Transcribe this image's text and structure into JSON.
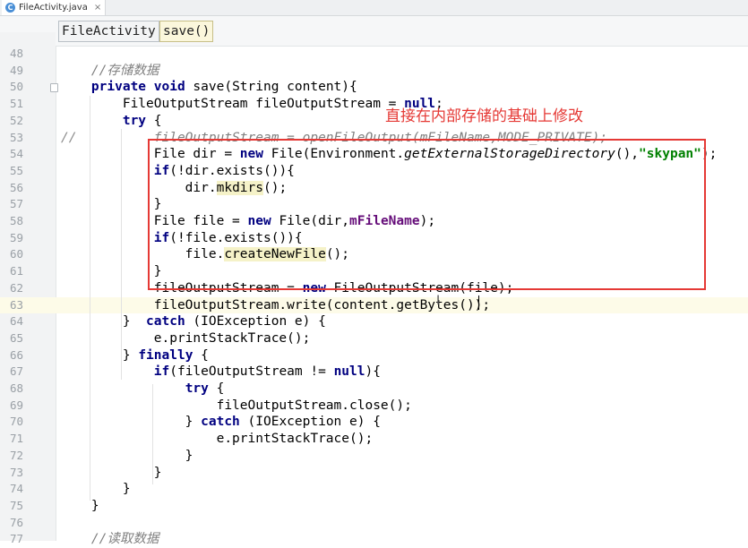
{
  "tab": {
    "icon": "C",
    "title": "FileActivity.java",
    "close": "×"
  },
  "breadcrumbs": [
    "FileActivity",
    "save()"
  ],
  "annotation": "直接在内部存储的基础上修改",
  "lines": [
    {
      "n": "48",
      "indent": 0,
      "tokens": []
    },
    {
      "n": "49",
      "indent": 0,
      "tokens": [
        {
          "t": "    //存储数据",
          "c": "cm"
        }
      ]
    },
    {
      "n": "50",
      "indent": 0,
      "fold": true,
      "tokens": [
        {
          "t": "    "
        },
        {
          "t": "private",
          "c": "kw"
        },
        {
          "t": " "
        },
        {
          "t": "void",
          "c": "kw"
        },
        {
          "t": " save(String content){"
        }
      ]
    },
    {
      "n": "51",
      "indent": 0,
      "tokens": [
        {
          "t": "        FileOutputStream fileOutputStream = "
        },
        {
          "t": "null",
          "c": "kw"
        },
        {
          "t": ";"
        }
      ]
    },
    {
      "n": "52",
      "indent": 0,
      "tokens": [
        {
          "t": "        "
        },
        {
          "t": "try",
          "c": "kw"
        },
        {
          "t": " {"
        }
      ]
    },
    {
      "n": "53",
      "indent": 0,
      "comment_marker": "//",
      "tokens": [
        {
          "t": "            fileOutputStream = openFileOutput(mFileName,MODE_PRIVATE);",
          "c": "cm"
        }
      ]
    },
    {
      "n": "54",
      "indent": 0,
      "tokens": [
        {
          "t": "            File dir = "
        },
        {
          "t": "new",
          "c": "kw"
        },
        {
          "t": " File(Environment."
        },
        {
          "t": "getExternalStorageDirectory",
          "c": "it"
        },
        {
          "t": "(),"
        },
        {
          "t": "\"skypan\"",
          "c": "st"
        },
        {
          "t": ");"
        }
      ]
    },
    {
      "n": "55",
      "indent": 0,
      "tokens": [
        {
          "t": "            "
        },
        {
          "t": "if",
          "c": "kw"
        },
        {
          "t": "(!dir.exists()){"
        }
      ]
    },
    {
      "n": "56",
      "indent": 0,
      "tokens": [
        {
          "t": "                dir."
        },
        {
          "t": "mkdirs",
          "c": "hl"
        },
        {
          "t": "();"
        }
      ]
    },
    {
      "n": "57",
      "indent": 0,
      "tokens": [
        {
          "t": "            }"
        }
      ]
    },
    {
      "n": "58",
      "indent": 0,
      "tokens": [
        {
          "t": "            File file = "
        },
        {
          "t": "new",
          "c": "kw"
        },
        {
          "t": " File(dir,"
        },
        {
          "t": "mFileName",
          "c": "fld"
        },
        {
          "t": ");"
        }
      ]
    },
    {
      "n": "59",
      "indent": 0,
      "tokens": [
        {
          "t": "            "
        },
        {
          "t": "if",
          "c": "kw"
        },
        {
          "t": "(!file.exists()){"
        }
      ]
    },
    {
      "n": "60",
      "indent": 0,
      "tokens": [
        {
          "t": "                file."
        },
        {
          "t": "createNewFile",
          "c": "hl"
        },
        {
          "t": "();"
        }
      ]
    },
    {
      "n": "61",
      "indent": 0,
      "tokens": [
        {
          "t": "            }"
        }
      ]
    },
    {
      "n": "62",
      "indent": 0,
      "tokens": [
        {
          "t": "            fileOutputStream = "
        },
        {
          "t": "new",
          "c": "kw"
        },
        {
          "t": " FileOutputStream(file);"
        }
      ]
    },
    {
      "n": "63",
      "indent": 0,
      "current": true,
      "tokens": [
        {
          "t": "            fileOutputStream.write(content.getBytes());"
        }
      ]
    },
    {
      "n": "64",
      "indent": 0,
      "tokens": [
        {
          "t": "        }  "
        },
        {
          "t": "catch",
          "c": "kw"
        },
        {
          "t": " (IOException e) {"
        }
      ]
    },
    {
      "n": "65",
      "indent": 0,
      "tokens": [
        {
          "t": "            e.printStackTrace();"
        }
      ]
    },
    {
      "n": "66",
      "indent": 0,
      "tokens": [
        {
          "t": "        } "
        },
        {
          "t": "finally",
          "c": "kw"
        },
        {
          "t": " {"
        }
      ]
    },
    {
      "n": "67",
      "indent": 0,
      "tokens": [
        {
          "t": "            "
        },
        {
          "t": "if",
          "c": "kw"
        },
        {
          "t": "(fileOutputStream != "
        },
        {
          "t": "null",
          "c": "kw"
        },
        {
          "t": "){"
        }
      ]
    },
    {
      "n": "68",
      "indent": 0,
      "tokens": [
        {
          "t": "                "
        },
        {
          "t": "try",
          "c": "kw"
        },
        {
          "t": " {"
        }
      ]
    },
    {
      "n": "69",
      "indent": 0,
      "tokens": [
        {
          "t": "                    fileOutputStream.close();"
        }
      ]
    },
    {
      "n": "70",
      "indent": 0,
      "tokens": [
        {
          "t": "                } "
        },
        {
          "t": "catch",
          "c": "kw"
        },
        {
          "t": " (IOException e) {"
        }
      ]
    },
    {
      "n": "71",
      "indent": 0,
      "tokens": [
        {
          "t": "                    e.printStackTrace();"
        }
      ]
    },
    {
      "n": "72",
      "indent": 0,
      "tokens": [
        {
          "t": "                }"
        }
      ]
    },
    {
      "n": "73",
      "indent": 0,
      "tokens": [
        {
          "t": "            }"
        }
      ]
    },
    {
      "n": "74",
      "indent": 0,
      "tokens": [
        {
          "t": "        }"
        }
      ]
    },
    {
      "n": "75",
      "indent": 0,
      "tokens": [
        {
          "t": "    }"
        }
      ]
    },
    {
      "n": "76",
      "indent": 0,
      "tokens": []
    },
    {
      "n": "77",
      "indent": 0,
      "tokens": [
        {
          "t": "    //读取数据",
          "c": "cm"
        }
      ]
    }
  ]
}
